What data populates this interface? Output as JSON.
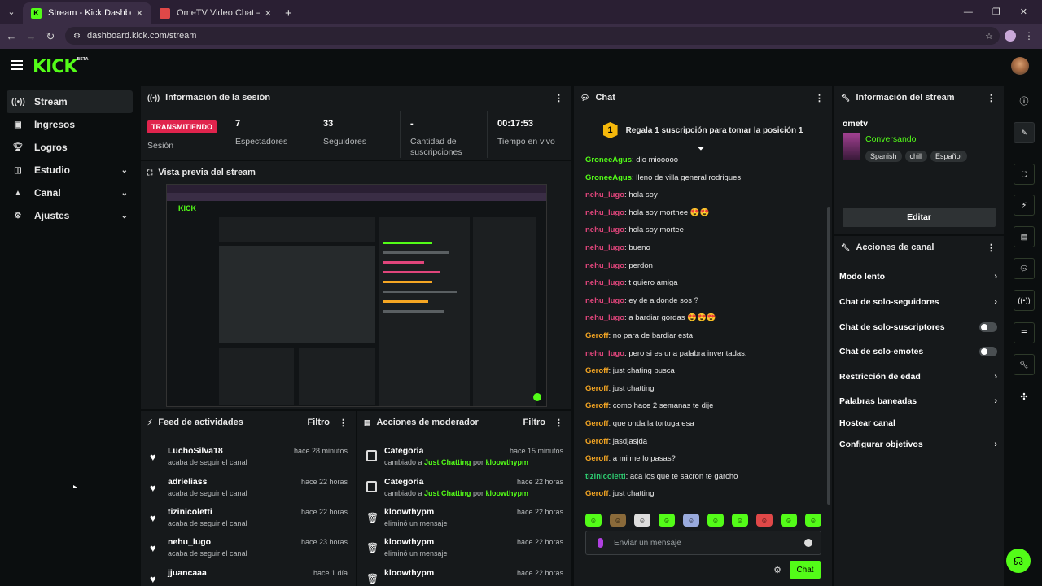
{
  "browser": {
    "tabs": [
      {
        "title": "Stream - Kick Dashboard",
        "active": true
      },
      {
        "title": "OmeTV Video Chat — Ome",
        "active": false
      }
    ],
    "url": "dashboard.kick.com/stream"
  },
  "brand": {
    "logo": "KICK",
    "logo_sup": "BETA",
    "accent": "#53fc18"
  },
  "sidebar": {
    "items": [
      {
        "label": "Stream",
        "icon": "broadcast-icon",
        "active": true
      },
      {
        "label": "Ingresos",
        "icon": "money-icon"
      },
      {
        "label": "Logros",
        "icon": "trophy-icon"
      },
      {
        "label": "Estudio",
        "icon": "studio-icon",
        "expandable": true
      },
      {
        "label": "Canal",
        "icon": "channel-icon",
        "expandable": true
      },
      {
        "label": "Ajustes",
        "icon": "gear-icon",
        "expandable": true
      }
    ]
  },
  "session": {
    "title": "Información de la sesión",
    "status_badge": "TRANSMITIENDO",
    "status_label": "Sesión",
    "stats": [
      {
        "value": "7",
        "label": "Espectadores"
      },
      {
        "value": "33",
        "label": "Seguidores"
      },
      {
        "value": "-",
        "label": "Cantidad de suscripciones"
      },
      {
        "value": "00:17:53",
        "label": "Tiempo en vivo"
      }
    ]
  },
  "preview": {
    "title": "Vista previa del stream"
  },
  "feed": {
    "title": "Feed de actividades",
    "filter": "Filtro",
    "items": [
      {
        "name": "LuchoSilva18",
        "sub": "acaba de seguir el canal",
        "time": "hace 28 minutos"
      },
      {
        "name": "adrieliass",
        "sub": "acaba de seguir el canal",
        "time": "hace 22 horas"
      },
      {
        "name": "tizinicoletti",
        "sub": "acaba de seguir el canal",
        "time": "hace 22 horas"
      },
      {
        "name": "nehu_lugo",
        "sub": "acaba de seguir el canal",
        "time": "hace 23 horas"
      },
      {
        "name": "jjuancaaa",
        "sub": "",
        "time": "hace 1 día"
      }
    ]
  },
  "moderator": {
    "title": "Acciones de moderador",
    "filter": "Filtro",
    "items": [
      {
        "name": "Categoria",
        "pre": "cambiado a ",
        "cat": "Just Chatting",
        "mid": " por ",
        "by": "kloowthypm",
        "time": "hace 15 minutos"
      },
      {
        "name": "Categoria",
        "pre": "cambiado a ",
        "cat": "Just Chatting",
        "mid": " por ",
        "by": "kloowthypm",
        "time": "hace 22 horas"
      },
      {
        "name": "kloowthypm",
        "pre": "eliminó un mensaje",
        "cat": "",
        "mid": "",
        "by": "",
        "time": "hace 22 horas"
      },
      {
        "name": "kloowthypm",
        "pre": "eliminó un mensaje",
        "cat": "",
        "mid": "",
        "by": "",
        "time": "hace 22 horas"
      },
      {
        "name": "kloowthypm",
        "pre": "",
        "cat": "",
        "mid": "",
        "by": "",
        "time": "hace 22 horas"
      }
    ]
  },
  "chat": {
    "title": "Chat",
    "pinned_num": "1",
    "pinned_text": "Regala 1 suscripción para tomar la posición 1",
    "messages": [
      {
        "user": "GroneeAgus",
        "color": "#53fc18",
        "text": "dio miooooo"
      },
      {
        "user": "GroneeAgus",
        "color": "#53fc18",
        "text": "lleno de villa general rodrigues"
      },
      {
        "user": "nehu_lugo",
        "color": "#e0457b",
        "text": "hola soy"
      },
      {
        "user": "nehu_lugo",
        "color": "#e0457b",
        "text": "hola soy morthee 😍😍"
      },
      {
        "user": "nehu_lugo",
        "color": "#e0457b",
        "text": "hola soy mortee"
      },
      {
        "user": "nehu_lugo",
        "color": "#e0457b",
        "text": "bueno"
      },
      {
        "user": "nehu_lugo",
        "color": "#e0457b",
        "text": "perdon"
      },
      {
        "user": "nehu_lugo",
        "color": "#e0457b",
        "text": "t quiero amiga"
      },
      {
        "user": "nehu_lugo",
        "color": "#e0457b",
        "text": "ey de a donde sos ?"
      },
      {
        "user": "nehu_lugo",
        "color": "#e0457b",
        "text": "a bardiar gordas 😍😍😍"
      },
      {
        "user": "Geroff",
        "color": "#f5a623",
        "text": "no para de bardiar esta"
      },
      {
        "user": "nehu_lugo",
        "color": "#e0457b",
        "text": "pero si es una palabra inventadas."
      },
      {
        "user": "Geroff",
        "color": "#f5a623",
        "text": "just chating busca"
      },
      {
        "user": "Geroff",
        "color": "#f5a623",
        "text": "just chatting"
      },
      {
        "user": "Geroff",
        "color": "#f5a623",
        "text": "como hace 2 semanas te dije"
      },
      {
        "user": "Geroff",
        "color": "#f5a623",
        "text": "que onda la tortuga esa"
      },
      {
        "user": "Geroff",
        "color": "#f5a623",
        "text": "jasdjasjda"
      },
      {
        "user": "Geroff",
        "color": "#f5a623",
        "text": "a mi me lo pasas?"
      },
      {
        "user": "tizinicoletti",
        "color": "#2ecc71",
        "text": "aca los que te sacron te garcho"
      },
      {
        "user": "Geroff",
        "color": "#f5a623",
        "text": "just chatting"
      }
    ],
    "input_placeholder": "Enviar un mensaje",
    "send_label": "Chat"
  },
  "stream_info": {
    "title": "Información del stream",
    "channel": "ometv",
    "stream_title": "Conversando",
    "tags": [
      "Spanish",
      "chill",
      "Español"
    ],
    "edit_label": "Editar"
  },
  "channel_actions": {
    "title": "Acciones de canal",
    "items": [
      {
        "label": "Modo lento",
        "control": "chevron"
      },
      {
        "label": "Chat de solo-seguidores",
        "control": "chevron"
      },
      {
        "label": "Chat de solo-suscriptores",
        "control": "toggle"
      },
      {
        "label": "Chat de solo-emotes",
        "control": "toggle"
      },
      {
        "label": "Restricción de edad",
        "control": "chevron"
      },
      {
        "label": "Palabras baneadas",
        "control": "chevron"
      },
      {
        "label": "Hostear canal",
        "control": "none"
      },
      {
        "label": "Configurar objetivos",
        "control": "chevron"
      }
    ]
  }
}
